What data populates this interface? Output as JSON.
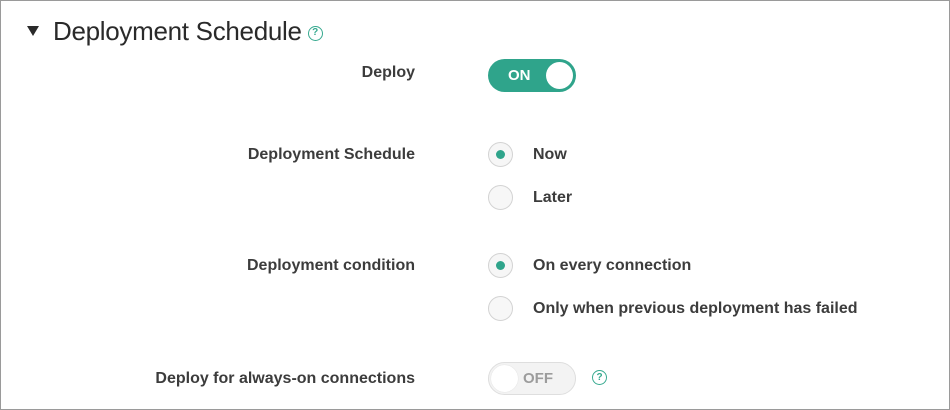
{
  "section": {
    "title": "Deployment Schedule",
    "help_glyph": "?"
  },
  "deploy": {
    "label": "Deploy",
    "toggle_text": "ON",
    "state": true
  },
  "schedule": {
    "label": "Deployment Schedule",
    "options": [
      {
        "label": "Now",
        "selected": true
      },
      {
        "label": "Later",
        "selected": false
      }
    ]
  },
  "condition": {
    "label": "Deployment condition",
    "options": [
      {
        "label": "On every connection",
        "selected": true
      },
      {
        "label": "Only when previous deployment has failed",
        "selected": false
      }
    ]
  },
  "always_on": {
    "label": "Deploy for always-on connections",
    "toggle_text": "OFF",
    "state": false,
    "help_glyph": "?"
  },
  "colors": {
    "accent": "#2fa48b",
    "help": "#36a98f",
    "text": "#3c3c3c"
  }
}
